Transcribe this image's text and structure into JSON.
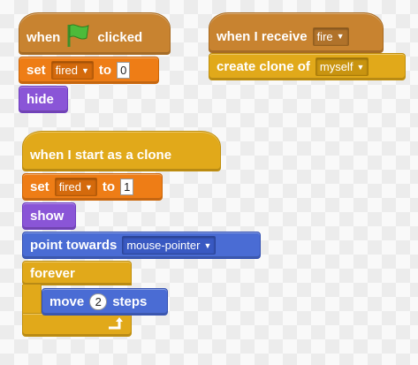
{
  "script1": {
    "hat": {
      "when": "when",
      "clicked": "clicked",
      "flag_icon": "green-flag-icon"
    },
    "set": {
      "label": "set",
      "var": "fired",
      "to": "to",
      "value": "0"
    },
    "hide": {
      "label": "hide"
    }
  },
  "script2": {
    "hat": {
      "when": "when I receive",
      "message": "fire"
    },
    "clone": {
      "label": "create clone of",
      "target": "myself"
    }
  },
  "script3": {
    "hat": {
      "label": "when I start as a clone"
    },
    "set": {
      "label": "set",
      "var": "fired",
      "to": "to",
      "value": "1"
    },
    "show": {
      "label": "show"
    },
    "point": {
      "label": "point towards",
      "target": "mouse-pointer"
    },
    "forever": {
      "label": "forever",
      "loop_icon": "loop-arrow-icon"
    },
    "move": {
      "label": "move",
      "value": "2",
      "steps": "steps"
    }
  },
  "colors": {
    "events": "#c88330",
    "data": "#ee7d16",
    "looks": "#8a55d7",
    "motion": "#4a6cd4",
    "control": "#e1a91a"
  }
}
